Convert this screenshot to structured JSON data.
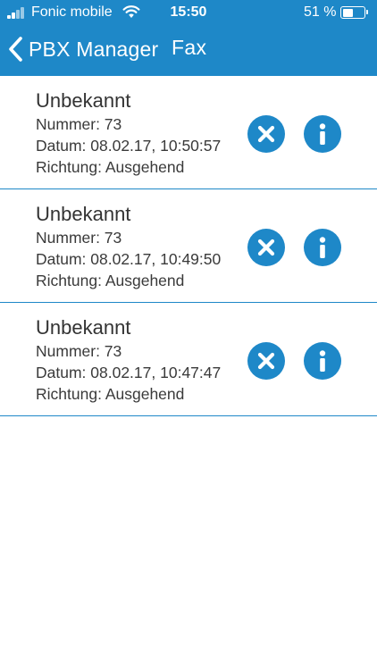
{
  "status_bar": {
    "carrier": "Fonic mobile",
    "time": "15:50",
    "battery_percent": "51 %",
    "battery_level": 0.51,
    "icons": [
      "signal-icon",
      "wifi-icon",
      "battery-icon"
    ]
  },
  "navbar": {
    "back_label": "PBX Manager",
    "title": "Fax",
    "back_icon": "chevron-left-icon"
  },
  "colors": {
    "accent": "#1e88c8",
    "text": "#333333",
    "background": "#ffffff"
  },
  "fax_items": [
    {
      "name": "Unbekannt",
      "number": "Nummer: 73",
      "date": "Datum: 08.02.17, 10:50:57",
      "direction": "Richtung: Ausgehend"
    },
    {
      "name": "Unbekannt",
      "number": "Nummer: 73",
      "date": "Datum: 08.02.17, 10:49:50",
      "direction": "Richtung: Ausgehend"
    },
    {
      "name": "Unbekannt",
      "number": "Nummer: 73",
      "date": "Datum: 08.02.17, 10:47:47",
      "direction": "Richtung: Ausgehend"
    }
  ],
  "row_icons": {
    "delete": "close-circle-icon",
    "info": "info-circle-icon"
  }
}
